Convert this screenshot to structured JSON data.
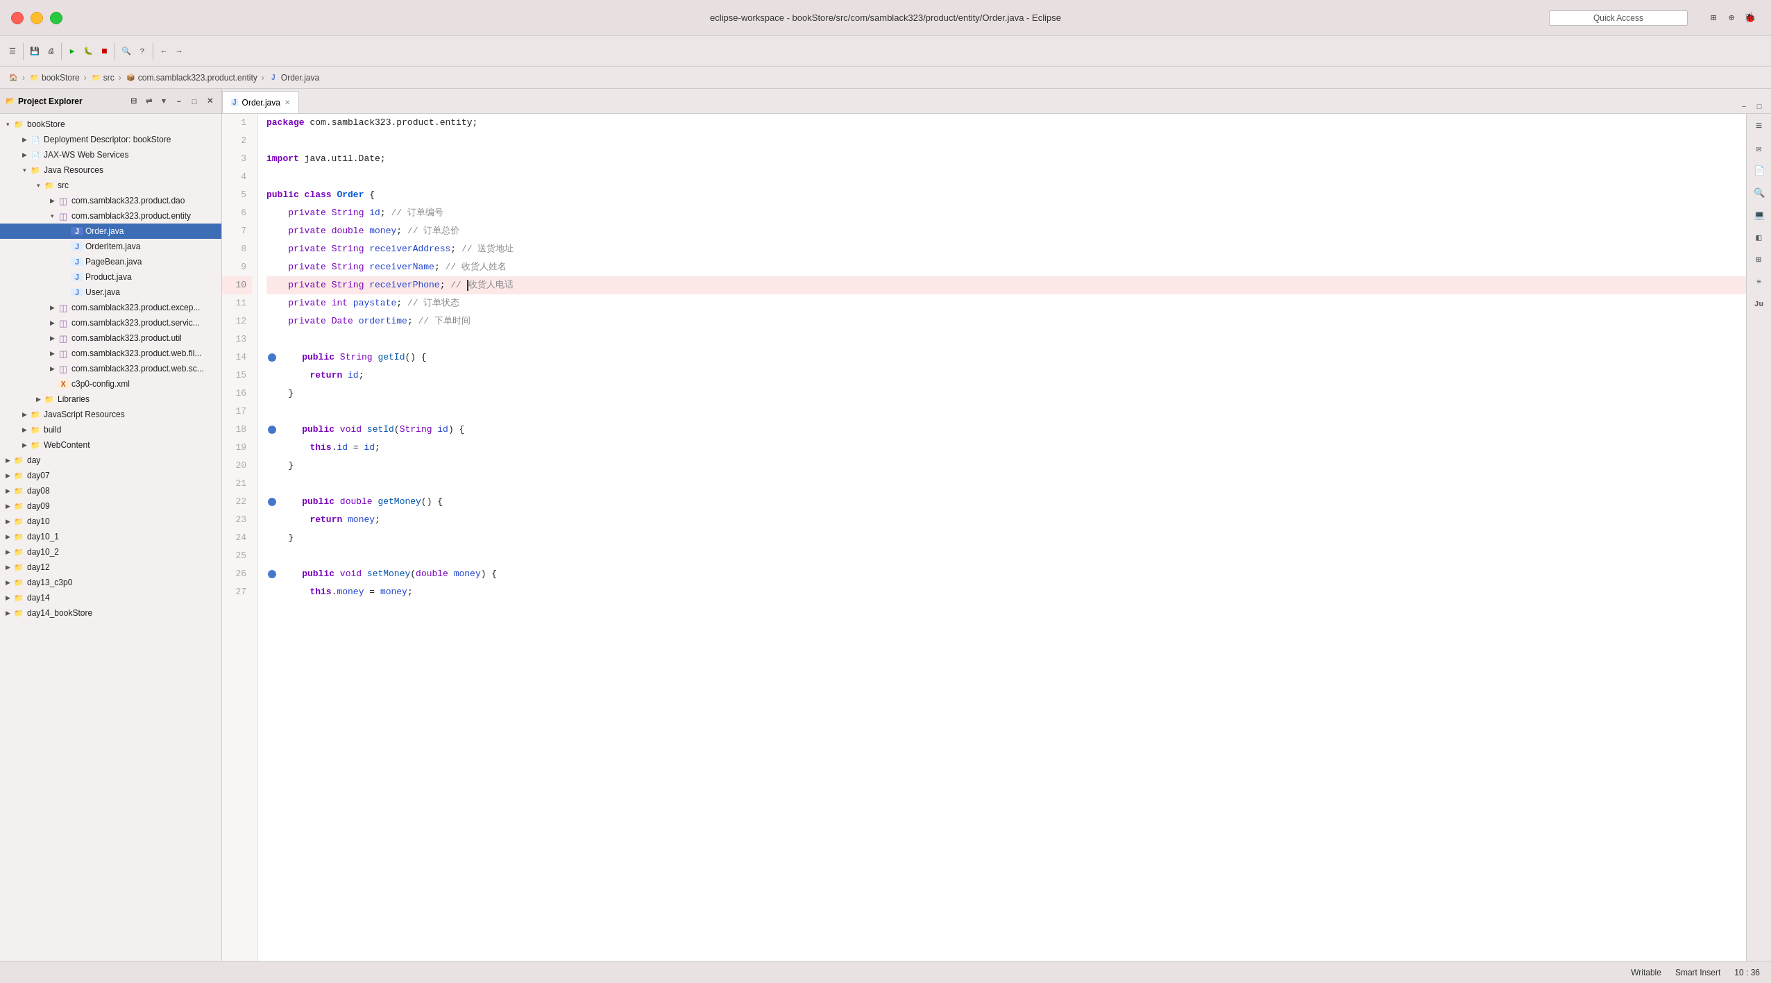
{
  "titlebar": {
    "title": "eclipse-workspace - bookStore/src/com/samblack323/product/entity/Order.java - Eclipse",
    "quick_access_placeholder": "Quick Access"
  },
  "breadcrumb": {
    "items": [
      "bookStore",
      "src",
      "com.samblack323.product.entity",
      "Order.java"
    ]
  },
  "sidebar": {
    "title": "Project Explorer",
    "tree": [
      {
        "id": "bookStore",
        "label": "bookStore",
        "level": 0,
        "icon": "📁",
        "expanded": true,
        "type": "project"
      },
      {
        "id": "deployment",
        "label": "Deployment Descriptor: bookStore",
        "level": 1,
        "icon": "📄",
        "expanded": false,
        "type": "descriptor"
      },
      {
        "id": "jaxws",
        "label": "JAX-WS Web Services",
        "level": 1,
        "icon": "📄",
        "expanded": false,
        "type": "service"
      },
      {
        "id": "java-resources",
        "label": "Java Resources",
        "level": 1,
        "icon": "📁",
        "expanded": true,
        "type": "folder"
      },
      {
        "id": "src",
        "label": "src",
        "level": 2,
        "icon": "📁",
        "expanded": true,
        "type": "srcfolder"
      },
      {
        "id": "dao",
        "label": "com.samblack323.product.dao",
        "level": 3,
        "icon": "📦",
        "expanded": false,
        "type": "package"
      },
      {
        "id": "entity",
        "label": "com.samblack323.product.entity",
        "level": 3,
        "icon": "📦",
        "expanded": true,
        "type": "package"
      },
      {
        "id": "Order.java",
        "label": "Order.java",
        "level": 4,
        "icon": "J",
        "expanded": false,
        "type": "java",
        "selected": true
      },
      {
        "id": "OrderItem.java",
        "label": "OrderItem.java",
        "level": 4,
        "icon": "J",
        "expanded": false,
        "type": "java"
      },
      {
        "id": "PageBean.java",
        "label": "PageBean.java",
        "level": 4,
        "icon": "J",
        "expanded": false,
        "type": "java"
      },
      {
        "id": "Product.java",
        "label": "Product.java",
        "level": 4,
        "icon": "J",
        "expanded": false,
        "type": "java"
      },
      {
        "id": "User.java",
        "label": "User.java",
        "level": 4,
        "icon": "J",
        "expanded": false,
        "type": "java"
      },
      {
        "id": "excep",
        "label": "com.samblack323.product.excep...",
        "level": 3,
        "icon": "📦",
        "expanded": false,
        "type": "package"
      },
      {
        "id": "servic",
        "label": "com.samblack323.product.servic...",
        "level": 3,
        "icon": "📦",
        "expanded": false,
        "type": "package"
      },
      {
        "id": "util",
        "label": "com.samblack323.product.util",
        "level": 3,
        "icon": "📦",
        "expanded": false,
        "type": "package"
      },
      {
        "id": "web-fil",
        "label": "com.samblack323.product.web.fil...",
        "level": 3,
        "icon": "📦",
        "expanded": false,
        "type": "package"
      },
      {
        "id": "web-sc",
        "label": "com.samblack323.product.web.sc...",
        "level": 3,
        "icon": "📦",
        "expanded": false,
        "type": "package"
      },
      {
        "id": "c3p0",
        "label": "c3p0-config.xml",
        "level": 3,
        "icon": "X",
        "expanded": false,
        "type": "xml"
      },
      {
        "id": "Libraries",
        "label": "Libraries",
        "level": 2,
        "icon": "📁",
        "expanded": false,
        "type": "folder"
      },
      {
        "id": "js-resources",
        "label": "JavaScript Resources",
        "level": 1,
        "icon": "📁",
        "expanded": false,
        "type": "folder"
      },
      {
        "id": "build",
        "label": "build",
        "level": 1,
        "icon": "📁",
        "expanded": false,
        "type": "folder"
      },
      {
        "id": "WebContent",
        "label": "WebContent",
        "level": 1,
        "icon": "📁",
        "expanded": false,
        "type": "folder"
      },
      {
        "id": "day",
        "label": "day",
        "level": 0,
        "icon": "📁",
        "expanded": false,
        "type": "project"
      },
      {
        "id": "day07",
        "label": "day07",
        "level": 0,
        "icon": "📁",
        "expanded": false,
        "type": "project"
      },
      {
        "id": "day08",
        "label": "day08",
        "level": 0,
        "icon": "📁",
        "expanded": false,
        "type": "project"
      },
      {
        "id": "day09",
        "label": "day09",
        "level": 0,
        "icon": "📁",
        "expanded": false,
        "type": "project"
      },
      {
        "id": "day10",
        "label": "day10",
        "level": 0,
        "icon": "📁",
        "expanded": false,
        "type": "project"
      },
      {
        "id": "day10_1",
        "label": "day10_1",
        "level": 0,
        "icon": "📁",
        "expanded": false,
        "type": "project"
      },
      {
        "id": "day10_2",
        "label": "day10_2",
        "level": 0,
        "icon": "📁",
        "expanded": false,
        "type": "project"
      },
      {
        "id": "day12",
        "label": "day12",
        "level": 0,
        "icon": "📁",
        "expanded": false,
        "type": "project"
      },
      {
        "id": "day13_c3p0",
        "label": "day13_c3p0",
        "level": 0,
        "icon": "📁",
        "expanded": false,
        "type": "project"
      },
      {
        "id": "day14",
        "label": "day14",
        "level": 0,
        "icon": "📁",
        "expanded": false,
        "type": "project"
      },
      {
        "id": "day14_bookStore",
        "label": "day14_bookStore",
        "level": 0,
        "icon": "📁",
        "expanded": false,
        "type": "project"
      }
    ]
  },
  "editor": {
    "filename": "Order.java",
    "tab_label": "Order.java",
    "lines": [
      {
        "num": 1,
        "content": "package com.samblack323.product.entity;",
        "type": "package"
      },
      {
        "num": 2,
        "content": "",
        "type": "blank"
      },
      {
        "num": 3,
        "content": "import java.util.Date;",
        "type": "import"
      },
      {
        "num": 4,
        "content": "",
        "type": "blank"
      },
      {
        "num": 5,
        "content": "public class Order {",
        "type": "code"
      },
      {
        "num": 6,
        "content": "    private String id; // 订单编号",
        "type": "code"
      },
      {
        "num": 7,
        "content": "    private double money; // 订单总价",
        "type": "code"
      },
      {
        "num": 8,
        "content": "    private String receiverAddress; // 送货地址",
        "type": "code"
      },
      {
        "num": 9,
        "content": "    private String receiverName; // 收货人姓名",
        "type": "code"
      },
      {
        "num": 10,
        "content": "    private String receiverPhone; // 收货人电话",
        "type": "code",
        "highlighted": true
      },
      {
        "num": 11,
        "content": "    private int paystate; // 订单状态",
        "type": "code"
      },
      {
        "num": 12,
        "content": "    private Date ordertime; // 下单时间",
        "type": "code"
      },
      {
        "num": 13,
        "content": "",
        "type": "blank"
      },
      {
        "num": 14,
        "content": "    public String getId() {",
        "type": "code",
        "has_breakpoint_indicator": true
      },
      {
        "num": 15,
        "content": "        return id;",
        "type": "code"
      },
      {
        "num": 16,
        "content": "    }",
        "type": "code"
      },
      {
        "num": 17,
        "content": "",
        "type": "blank"
      },
      {
        "num": 18,
        "content": "    public void setId(String id) {",
        "type": "code",
        "has_breakpoint_indicator": true
      },
      {
        "num": 19,
        "content": "        this.id = id;",
        "type": "code"
      },
      {
        "num": 20,
        "content": "    }",
        "type": "code"
      },
      {
        "num": 21,
        "content": "",
        "type": "blank"
      },
      {
        "num": 22,
        "content": "    public double getMoney() {",
        "type": "code",
        "has_breakpoint_indicator": true
      },
      {
        "num": 23,
        "content": "        return money;",
        "type": "code"
      },
      {
        "num": 24,
        "content": "    }",
        "type": "code"
      },
      {
        "num": 25,
        "content": "",
        "type": "blank"
      },
      {
        "num": 26,
        "content": "    public void setMoney(double money) {",
        "type": "code",
        "has_breakpoint_indicator": true
      },
      {
        "num": 27,
        "content": "        this.money = money;",
        "type": "code"
      }
    ]
  },
  "statusbar": {
    "writable": "Writable",
    "smart_insert": "Smart Insert",
    "position": "10 : 36"
  },
  "right_sidebar": {
    "icons": [
      "≡",
      "✉",
      "📄",
      "🔍",
      "💻",
      "◧",
      "≡",
      "Ju"
    ]
  }
}
